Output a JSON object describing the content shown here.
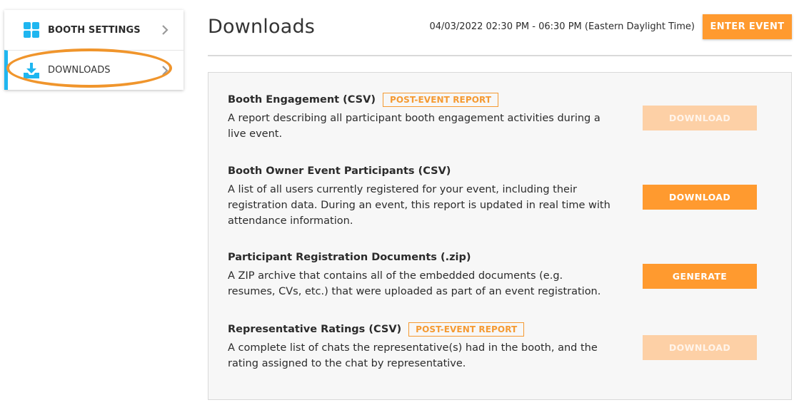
{
  "sidebar": {
    "items": [
      {
        "label": "BOOTH SETTINGS",
        "icon": "grid-icon"
      },
      {
        "label": "DOWNLOADS",
        "icon": "download-icon"
      }
    ]
  },
  "header": {
    "title": "Downloads",
    "event_time": "04/03/2022 02:30 PM - 06:30 PM (Eastern Daylight Time)",
    "enter_button": "ENTER EVENT"
  },
  "reports": [
    {
      "title": "Booth Engagement (CSV)",
      "badge": "POST-EVENT REPORT",
      "description": "A report describing all participant booth engagement activities during a live event.",
      "button": "DOWNLOAD",
      "button_state": "disabled"
    },
    {
      "title": "Booth Owner Event Participants (CSV)",
      "badge": "",
      "description": "A list of all users currently registered for your event, including their registration data. During an event, this report is updated in real time with attendance information.",
      "button": "DOWNLOAD",
      "button_state": "enabled"
    },
    {
      "title": "Participant Registration Documents (.zip)",
      "badge": "",
      "description": "A ZIP archive that contains all of the embedded documents (e.g. resumes, CVs, etc.) that were uploaded as part of an event registration.",
      "button": "GENERATE",
      "button_state": "enabled"
    },
    {
      "title": "Representative Ratings (CSV)",
      "badge": "POST-EVENT REPORT",
      "description": "A complete list of chats the representative(s) had in the booth, and the rating assigned to the chat by representative.",
      "button": "DOWNLOAD",
      "button_state": "disabled"
    }
  ],
  "colors": {
    "accent": "#ff9a2f",
    "accent_disabled": "#fdd0a6",
    "active_indicator": "#1fb6f0",
    "highlight_ring": "#f0952c"
  }
}
